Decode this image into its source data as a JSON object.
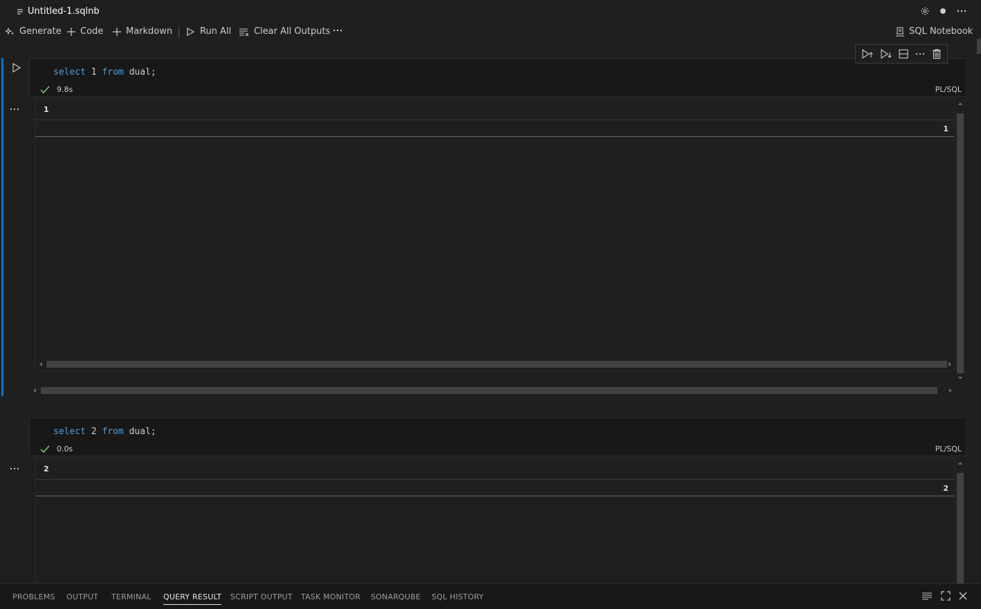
{
  "window": {
    "file_title": "Untitled-1.sqlnb"
  },
  "toolbar": {
    "generate": "Generate",
    "code": "Code",
    "markdown": "Markdown",
    "run_all": "Run All",
    "clear_outputs": "Clear All Outputs",
    "kernel": "SQL Notebook"
  },
  "cells": [
    {
      "code": {
        "kw1": "select",
        "num": " 1 ",
        "kw2": "from",
        "rest": " dual;"
      },
      "duration": "9.8s",
      "language": "PL/SQL",
      "result": {
        "column": "1",
        "row_value": "1"
      }
    },
    {
      "code": {
        "kw1": "select",
        "num": " 2 ",
        "kw2": "from",
        "rest": " dual;"
      },
      "duration": "0.0s",
      "language": "PL/SQL",
      "result": {
        "column": "2",
        "row_value": "2"
      }
    }
  ],
  "panel": {
    "tabs": [
      "PROBLEMS",
      "OUTPUT",
      "TERMINAL",
      "QUERY RESULT",
      "SCRIPT OUTPUT",
      "TASK MONITOR",
      "SONARQUBE",
      "SQL HISTORY"
    ],
    "active_tab": "QUERY RESULT"
  },
  "colors": {
    "accent": "#0078d4",
    "keyword": "#569cd6",
    "success": "#89d185"
  }
}
